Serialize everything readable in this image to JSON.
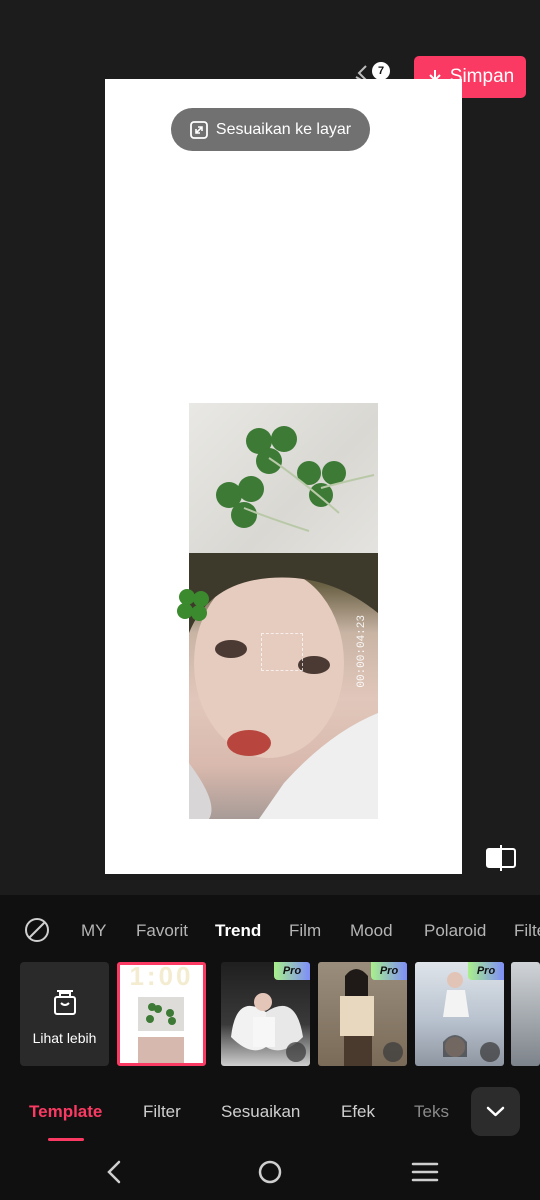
{
  "header": {
    "layers_count": "7",
    "save_label": "Simpan"
  },
  "canvas": {
    "fit_label": "Sesuaikan ke layar",
    "camera_timecode": "00:00:04:23"
  },
  "categories": {
    "items": [
      "MY",
      "Favorit",
      "Trend",
      "Film",
      "Mood",
      "Polaroid",
      "Filte"
    ],
    "active": "Trend"
  },
  "thumbnails": {
    "more_label": "Lihat lebih",
    "selected_overlay_text": "1:00",
    "pro_label": "Pro"
  },
  "tabs": {
    "items": [
      "Template",
      "Filter",
      "Sesuaikan",
      "Efek",
      "Teks"
    ],
    "active": "Template"
  },
  "colors": {
    "accent": "#fb3a63",
    "panel_bg": "#101010",
    "app_bg": "#1c1c1c"
  }
}
